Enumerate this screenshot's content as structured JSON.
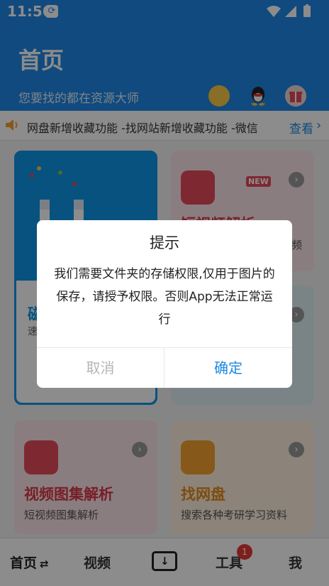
{
  "status": {
    "time": "11:56"
  },
  "header": {
    "title": "首页",
    "subtitle": "您要找的都在资源大师"
  },
  "ticker": {
    "text": "网盘新增收藏功能 -找网站新增收藏功能 -微信",
    "more": "查看"
  },
  "cards": [
    {
      "name": "磁",
      "desc": "速"
    },
    {
      "name": "短视频解析",
      "desc": "频",
      "badge": "NEW"
    },
    {
      "name": "",
      "desc": ""
    },
    {
      "name": "视频图集解析",
      "desc": "短视频图集解析"
    },
    {
      "name": "找网盘",
      "desc": "搜索各种考研学习资料"
    }
  ],
  "dialog": {
    "title": "提示",
    "message": "我们需要文件夹的存储权限,仅用于图片的保存，请授予权限。否则App无法正常运行",
    "cancel": "取消",
    "confirm": "确定"
  },
  "bottom_nav": {
    "home": "首页",
    "video": "视频",
    "tools": "工具",
    "tools_badge": "1",
    "me": "我"
  },
  "colors": {
    "primary": "#1e88e5",
    "card_red": "#e64b5c",
    "card_orange": "#f4a12e"
  }
}
